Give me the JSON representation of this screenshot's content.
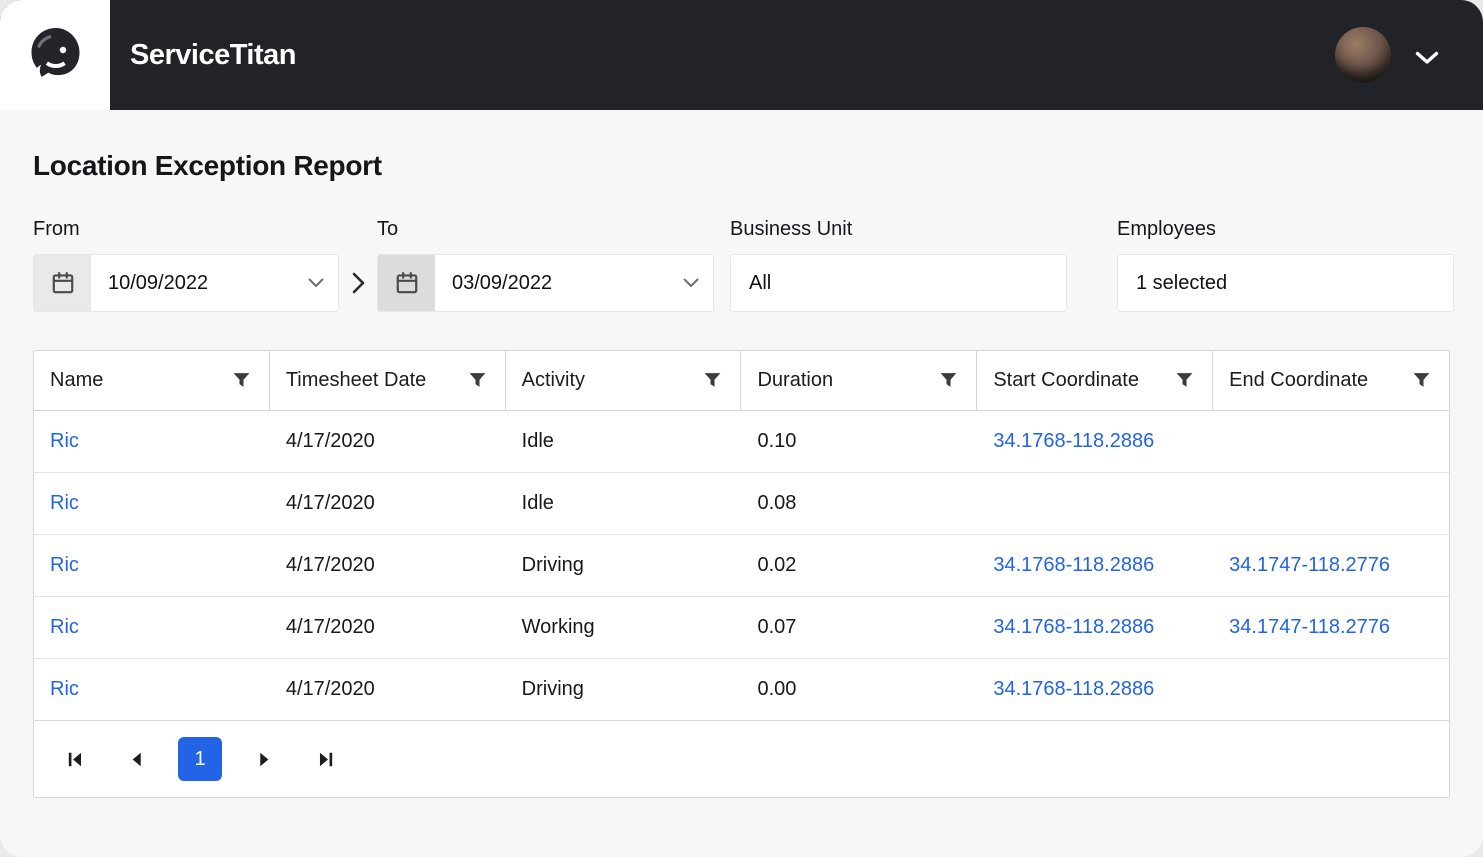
{
  "header": {
    "brand": "ServiceTitan"
  },
  "page_title": "Location Exception Report",
  "filters": {
    "from": {
      "label": "From",
      "value": "10/09/2022"
    },
    "to": {
      "label": "To",
      "value": "03/09/2022"
    },
    "business_unit": {
      "label": "Business Unit",
      "value": "All"
    },
    "employees": {
      "label": "Employees",
      "value": "1 selected"
    }
  },
  "table": {
    "columns": [
      {
        "label": "Name"
      },
      {
        "label": "Timesheet Date"
      },
      {
        "label": "Activity"
      },
      {
        "label": "Duration"
      },
      {
        "label": "Start Coordinate"
      },
      {
        "label": "End Coordinate"
      }
    ],
    "rows": [
      {
        "name": "Ric",
        "timesheet_date": "4/17/2020",
        "activity": "Idle",
        "duration": "0.10",
        "start_coordinate": "34.1768-118.2886",
        "end_coordinate": ""
      },
      {
        "name": "Ric",
        "timesheet_date": "4/17/2020",
        "activity": "Idle",
        "duration": "0.08",
        "start_coordinate": "",
        "end_coordinate": ""
      },
      {
        "name": "Ric",
        "timesheet_date": "4/17/2020",
        "activity": "Driving",
        "duration": "0.02",
        "start_coordinate": "34.1768-118.2886",
        "end_coordinate": "34.1747-118.2776"
      },
      {
        "name": "Ric",
        "timesheet_date": "4/17/2020",
        "activity": "Working",
        "duration": "0.07",
        "start_coordinate": "34.1768-118.2886",
        "end_coordinate": "34.1747-118.2776"
      },
      {
        "name": "Ric",
        "timesheet_date": "4/17/2020",
        "activity": "Driving",
        "duration": "0.00",
        "start_coordinate": "34.1768-118.2886",
        "end_coordinate": ""
      }
    ]
  },
  "pagination": {
    "current_page": "1"
  },
  "colors": {
    "accent_blue": "#2264e5",
    "header_bg": "#212329",
    "link_blue": "#2264e5"
  }
}
